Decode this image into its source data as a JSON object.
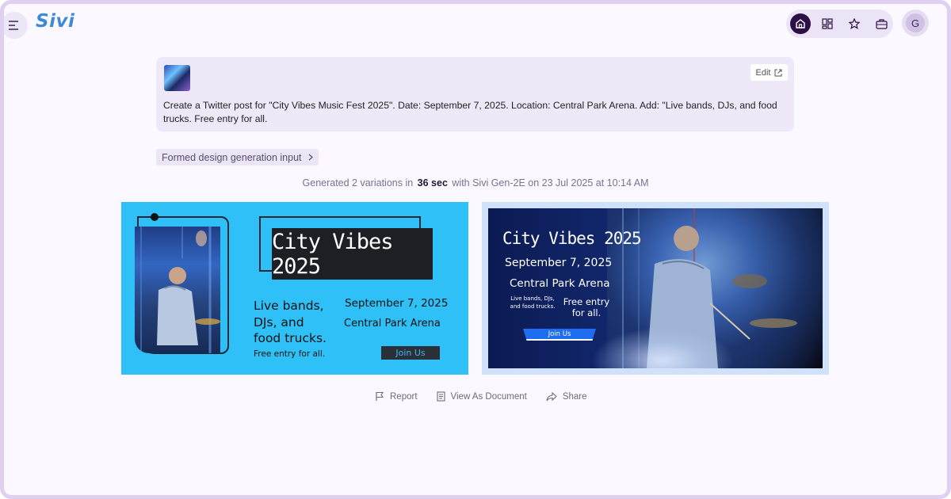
{
  "app": {
    "logo": "Sivi"
  },
  "header": {
    "nav": [
      "home-icon",
      "grid-icon",
      "star-icon",
      "briefcase-icon"
    ],
    "avatar_initial": "G"
  },
  "prompt": {
    "edit_label": "Edit",
    "text": "Create a Twitter post for \"City Vibes Music Fest 2025\". Date: September 7, 2025. Location: Central Park Arena. Add: \"Live bands, DJs, and food trucks. Free entry for all."
  },
  "formed_input_label": "Formed design generation input",
  "generation": {
    "prefix": "Generated 2 variations in",
    "duration": "36 sec",
    "model": "with Sivi Gen-2E",
    "date": "on 23 Jul 2025 at 10:14 AM"
  },
  "variation1": {
    "title": "City Vibes 2025",
    "left_text_1": "Live bands,",
    "left_text_2": "DJs, and",
    "left_text_3": "food trucks.",
    "free_text": "Free entry for all.",
    "date": "September 7, 2025",
    "location": "Central Park Arena",
    "cta": "Join Us",
    "bg_color": "#2ec0f7"
  },
  "variation2": {
    "title": "City Vibes 2025",
    "date": "September 7, 2025",
    "location": "Central Park Arena",
    "small_text": "Live bands, DJs, and food trucks.",
    "free_text": "Free entry for all.",
    "cta": "Join Us",
    "bg_color": "#0b1a52"
  },
  "actions": {
    "report": "Report",
    "view_as_document": "View As Document",
    "share": "Share"
  }
}
